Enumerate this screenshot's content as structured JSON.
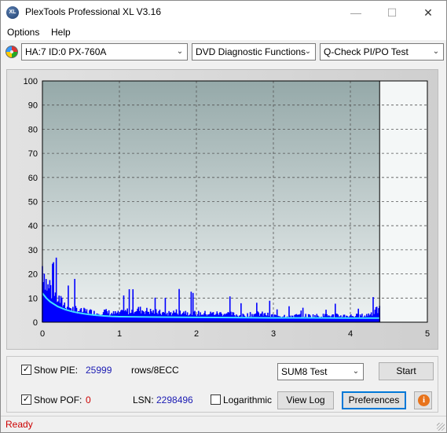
{
  "window": {
    "title": "PlexTools Professional XL V3.16",
    "icon_text": "XL"
  },
  "menu": {
    "options": "Options",
    "help": "Help"
  },
  "toolbar": {
    "drive": "HA:7 ID:0  PX-760A",
    "function": "DVD Diagnostic Functions",
    "test": "Q-Check PI/PO Test"
  },
  "chart_data": {
    "type": "area",
    "title": "",
    "xlabel": "",
    "ylabel": "",
    "xlim": [
      0,
      5
    ],
    "ylim": [
      0,
      100
    ],
    "x_ticks": [
      "0",
      "1",
      "2",
      "3",
      "4",
      "5"
    ],
    "y_ticks": [
      "0",
      "10",
      "20",
      "30",
      "40",
      "50",
      "60",
      "70",
      "80",
      "90",
      "100"
    ],
    "grid": true,
    "end_marker_x": 4.38,
    "series": [
      {
        "color": "#0000ff",
        "kind": "bars",
        "x": [
          0.0,
          0.02,
          0.04,
          0.06,
          0.08,
          0.1,
          0.12,
          0.15,
          0.2,
          0.25,
          0.3,
          0.35,
          0.4,
          0.45,
          0.5,
          0.6,
          0.7,
          0.8,
          0.9,
          1.0,
          1.2,
          1.4,
          1.6,
          1.8,
          2.0,
          2.2,
          2.4,
          2.6,
          2.8,
          3.0,
          3.2,
          3.4,
          3.6,
          3.8,
          4.0,
          4.2,
          4.38
        ],
        "y": [
          26,
          24,
          20,
          17,
          15,
          18,
          14,
          13,
          11,
          9,
          8,
          7,
          6,
          6,
          5,
          5,
          4,
          5,
          4,
          4,
          6,
          5,
          4,
          5,
          4,
          4,
          4,
          3,
          4,
          3,
          3,
          3,
          3,
          3,
          3,
          3,
          6
        ]
      },
      {
        "color": "#40e0ff",
        "kind": "line",
        "x": [
          0.0,
          0.05,
          0.1,
          0.15,
          0.2,
          0.3,
          0.4,
          0.5,
          0.6,
          0.7,
          0.8,
          0.9,
          1.0,
          1.5,
          2.0,
          2.5,
          3.0,
          3.5,
          4.0,
          4.38
        ],
        "y": [
          12,
          10,
          8.5,
          7.5,
          6.5,
          5.2,
          4.3,
          3.7,
          3.2,
          2.9,
          2.6,
          2.4,
          2.3,
          2.1,
          2.0,
          1.9,
          1.8,
          1.8,
          1.7,
          1.7
        ]
      }
    ]
  },
  "controls": {
    "show_pie_label": "Show PIE:",
    "pie_value": "25999",
    "pie_unit": "rows/8ECC",
    "show_pof_label": "Show POF:",
    "pof_value": "0",
    "lsn_label": "LSN:",
    "lsn_value": "2298496",
    "logarithmic_label": "Logarithmic",
    "test_select": "SUM8 Test",
    "start_button": "Start",
    "viewlog_button": "View Log",
    "preferences_button": "Preferences",
    "info_icon_text": "i",
    "show_pie_checked": true,
    "show_pof_checked": true,
    "logarithmic_checked": false
  },
  "status": {
    "text": "Ready"
  }
}
